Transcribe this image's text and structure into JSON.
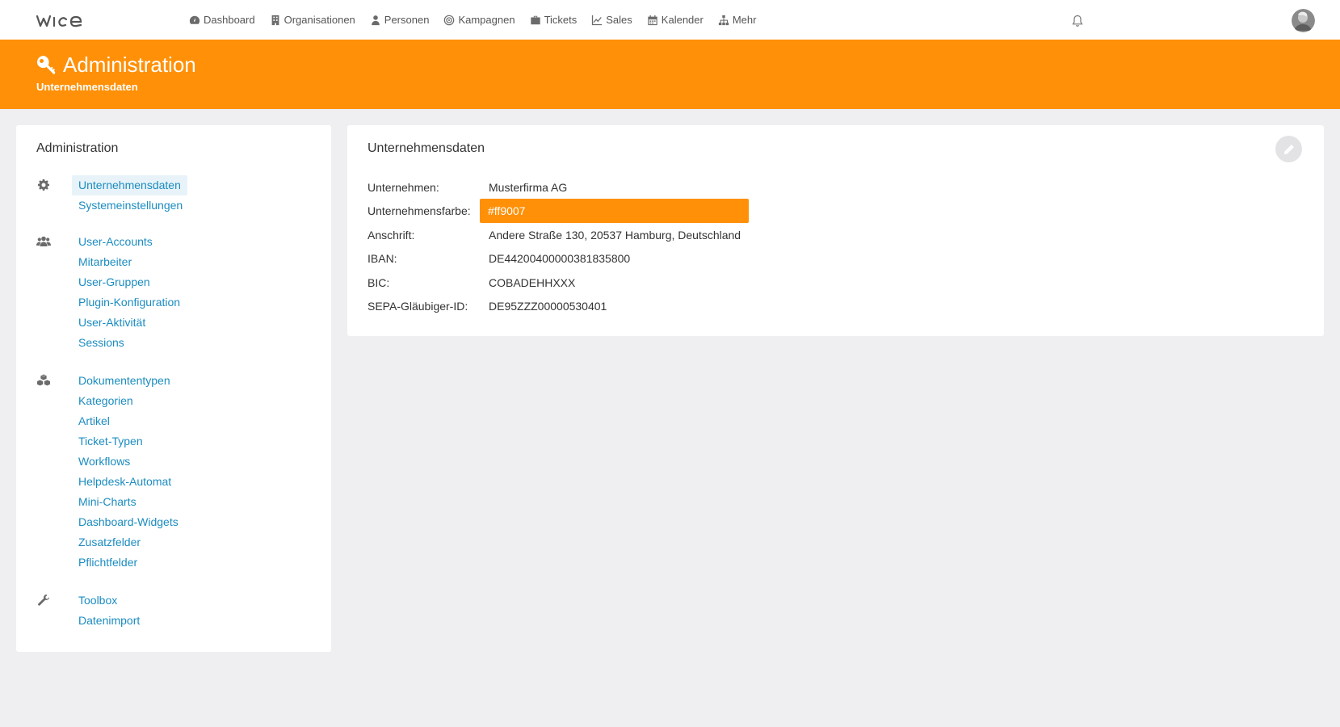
{
  "app": {
    "logo_text": "wice"
  },
  "nav": {
    "items": [
      {
        "label": "Dashboard",
        "icon": "dashboard-icon"
      },
      {
        "label": "Organisationen",
        "icon": "building-icon"
      },
      {
        "label": "Personen",
        "icon": "user-icon"
      },
      {
        "label": "Kampagnen",
        "icon": "target-icon"
      },
      {
        "label": "Tickets",
        "icon": "briefcase-icon"
      },
      {
        "label": "Sales",
        "icon": "line-chart-icon"
      },
      {
        "label": "Kalender",
        "icon": "calendar-icon"
      },
      {
        "label": "Mehr",
        "icon": "sitemap-icon"
      }
    ]
  },
  "header": {
    "title": "Administration",
    "subtitle": "Unternehmensdaten",
    "color": "#ff9007"
  },
  "sidebar": {
    "title": "Administration",
    "groups": [
      {
        "icon": "gear-icon",
        "links": [
          "Unternehmensdaten",
          "Systemeinstellungen"
        ]
      },
      {
        "icon": "users-icon",
        "links": [
          "User-Accounts",
          "Mitarbeiter",
          "User-Gruppen",
          "Plugin-Konfiguration",
          "User-Aktivität",
          "Sessions"
        ]
      },
      {
        "icon": "cubes-icon",
        "links": [
          "Dokumententypen",
          "Kategorien",
          "Artikel",
          "Ticket-Typen",
          "Workflows",
          "Helpdesk-Automat",
          "Mini-Charts",
          "Dashboard-Widgets",
          "Zusatzfelder",
          "Pflichtfelder"
        ]
      },
      {
        "icon": "wrench-icon",
        "links": [
          "Toolbox",
          "Datenimport"
        ]
      }
    ],
    "active": "Unternehmensdaten",
    "link_color": "#1b8cc0"
  },
  "main": {
    "title": "Unternehmensdaten",
    "fields": [
      {
        "label": "Unternehmen:",
        "value": "Musterfirma AG"
      },
      {
        "label": "Unternehmensfarbe:",
        "value": "#ff9007"
      },
      {
        "label": "Anschrift:",
        "value": "Andere Straße 130, 20537 Hamburg, Deutschland"
      },
      {
        "label": "IBAN:",
        "value": "DE44200400000381835800"
      },
      {
        "label": "BIC:",
        "value": "COBADEHHXXX"
      },
      {
        "label": "SEPA-Gläubiger-ID:",
        "value": "DE95ZZZ00000530401"
      }
    ]
  }
}
